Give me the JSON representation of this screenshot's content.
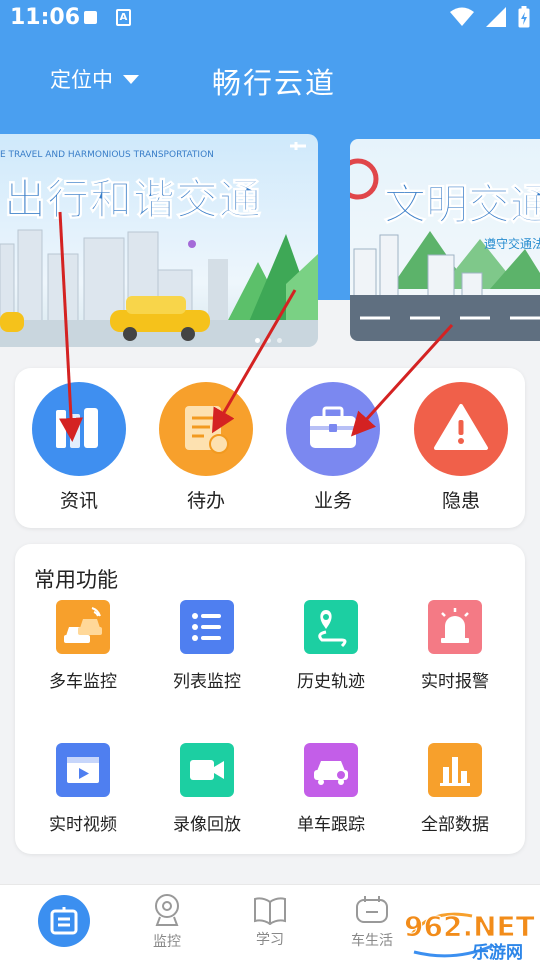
{
  "status_bar": {
    "time": "11:06",
    "a_icon": "A"
  },
  "header": {
    "location": "定位中",
    "title": "畅行云道"
  },
  "banners": [
    {
      "small_text": "E TRAVEL AND HARMONIOUS TRANSPORTATION",
      "big_text": "出行和谐交通"
    },
    {
      "big_text": "文明交通",
      "small_text": "遵守交通法"
    }
  ],
  "quick_actions": [
    {
      "label": "资讯",
      "icon": "books-icon",
      "color": "#3f8ff0"
    },
    {
      "label": "待办",
      "icon": "task-icon",
      "color": "#f7a02c"
    },
    {
      "label": "业务",
      "icon": "briefcase-icon",
      "color": "#7b88f0"
    },
    {
      "label": "隐患",
      "icon": "warning-icon",
      "color": "#f0604a"
    }
  ],
  "common": {
    "title": "常用功能",
    "items": [
      {
        "label": "多车监控",
        "icon": "multi-car-icon",
        "color": "#f7a02c"
      },
      {
        "label": "列表监控",
        "icon": "list-icon",
        "color": "#4f7ff0"
      },
      {
        "label": "历史轨迹",
        "icon": "track-icon",
        "color": "#1ccfa2"
      },
      {
        "label": "实时报警",
        "icon": "alarm-icon",
        "color": "#f47a85"
      },
      {
        "label": "实时视频",
        "icon": "video-icon",
        "color": "#4f7ff0"
      },
      {
        "label": "录像回放",
        "icon": "camera-icon",
        "color": "#1ccfa2"
      },
      {
        "label": "单车跟踪",
        "icon": "car-track-icon",
        "color": "#c35ee8"
      },
      {
        "label": "全部数据",
        "icon": "bar-chart-icon",
        "color": "#f7a02c"
      }
    ]
  },
  "bottom_nav": [
    {
      "label": "",
      "icon": "home-icon"
    },
    {
      "label": "监控",
      "icon": "webcam-icon"
    },
    {
      "label": "学习",
      "icon": "book-icon"
    },
    {
      "label": "车生活",
      "icon": "car-life-icon"
    }
  ],
  "watermark": {
    "text": "962.NET",
    "subtext": "乐游网"
  }
}
